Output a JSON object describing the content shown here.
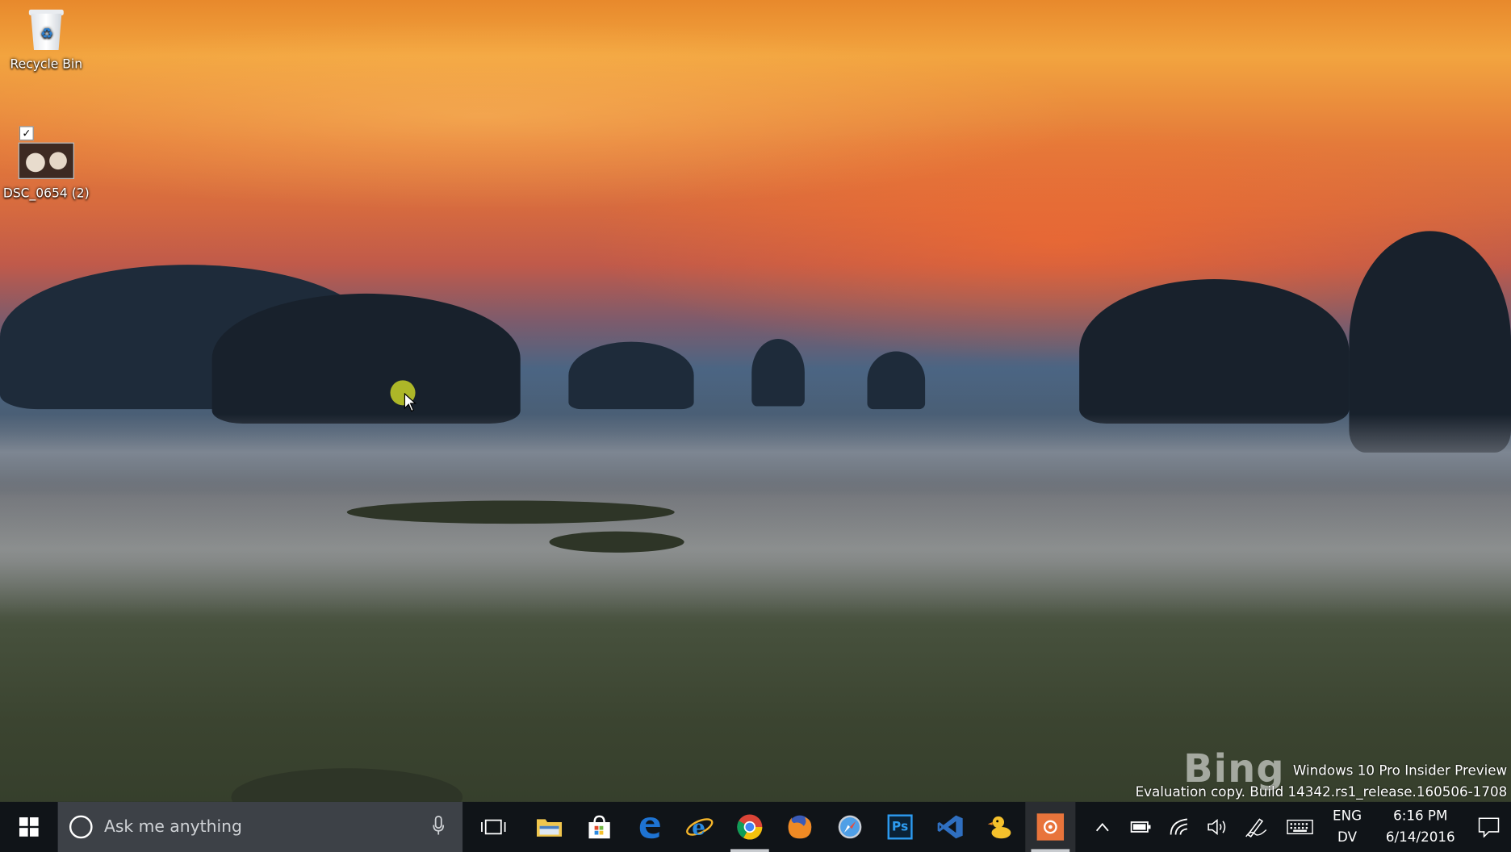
{
  "desktop": {
    "icons": [
      {
        "label": "Recycle Bin",
        "icon": "recycle-bin-icon"
      },
      {
        "label": "DSC_0654 (2)",
        "icon": "photo-thumbnail-icon",
        "selected": true
      }
    ]
  },
  "watermark": {
    "brand": "Bing",
    "line1": "Windows 10 Pro Insider Preview",
    "line2": "Evaluation copy. Build 14342.rs1_release.160506-1708"
  },
  "taskbar": {
    "search_placeholder": "Ask me anything",
    "pinned": [
      {
        "name": "task-view",
        "icon": "task-view-icon"
      },
      {
        "name": "file-explorer",
        "icon": "folder-icon"
      },
      {
        "name": "store",
        "icon": "store-icon"
      },
      {
        "name": "edge",
        "icon": "edge-icon"
      },
      {
        "name": "internet-explorer",
        "icon": "ie-icon"
      },
      {
        "name": "chrome",
        "icon": "chrome-icon",
        "active": true
      },
      {
        "name": "firefox",
        "icon": "firefox-icon"
      },
      {
        "name": "safari",
        "icon": "safari-icon"
      },
      {
        "name": "photoshop",
        "icon": "photoshop-icon",
        "label": "Ps"
      },
      {
        "name": "visual-studio",
        "icon": "visual-studio-icon"
      },
      {
        "name": "cyberduck",
        "icon": "duck-icon"
      },
      {
        "name": "screen-recorder",
        "icon": "recorder-icon",
        "active": true
      }
    ],
    "tray": {
      "lang_top": "ENG",
      "lang_bottom": "DV",
      "time": "6:16 PM",
      "date": "6/14/2016"
    }
  },
  "colors": {
    "taskbar_bg": "#101418",
    "search_bg": "#3d4147",
    "edge_blue": "#1e73d2",
    "ps_blue": "#2d6db6",
    "vs_purple": "#2f6fc0",
    "recorder_orange": "#e8743b"
  }
}
